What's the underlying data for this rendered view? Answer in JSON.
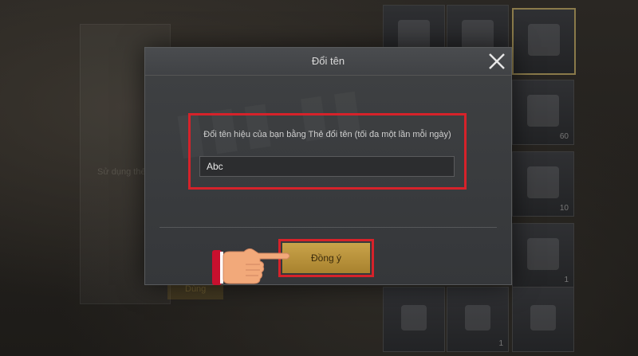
{
  "dialog": {
    "title": "Đổi tên",
    "prompt": "Đổi tên hiệu của bạn bằng Thẻ đổi tên (tối đa một lần mỗi ngày)",
    "name_value": "Abc",
    "confirm_label": "Đồng ý",
    "close_icon": "close-icon"
  },
  "background": {
    "hint_text": "Sử dụng thẻ",
    "bottom_button_label": "Dùng",
    "inventory_counts": [
      "60",
      "10",
      "1",
      "1"
    ]
  },
  "colors": {
    "highlight": "#d6222a",
    "confirm_button": "#c9a34a",
    "dialog_bg": "#3f4143",
    "hand_cuff": "#c8102e",
    "hand_skin": "#f2a97a"
  },
  "icons": {
    "pointer": "hand-pointer-icon"
  }
}
